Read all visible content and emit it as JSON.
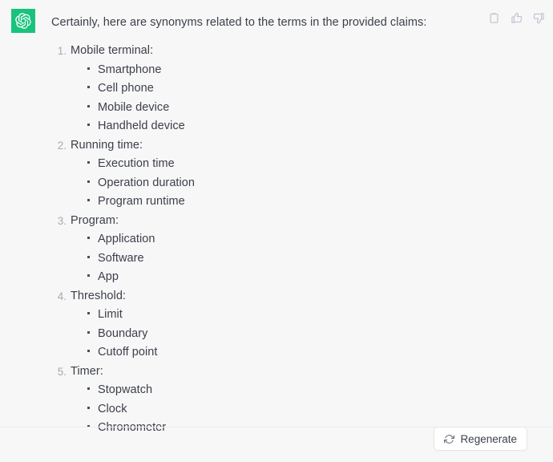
{
  "avatar": {
    "icon": "openai-logo-icon",
    "background": "#19c37d"
  },
  "message": {
    "intro": "Certainly, here are synonyms related to the terms in the provided claims:",
    "items": [
      {
        "number": "1.",
        "term": "Mobile terminal:",
        "synonyms": [
          "Smartphone",
          "Cell phone",
          "Mobile device",
          "Handheld device"
        ]
      },
      {
        "number": "2.",
        "term": "Running time:",
        "synonyms": [
          "Execution time",
          "Operation duration",
          "Program runtime"
        ]
      },
      {
        "number": "3.",
        "term": "Program:",
        "synonyms": [
          "Application",
          "Software",
          "App"
        ]
      },
      {
        "number": "4.",
        "term": "Threshold:",
        "synonyms": [
          "Limit",
          "Boundary",
          "Cutoff point"
        ]
      },
      {
        "number": "5.",
        "term": "Timer:",
        "synonyms": [
          "Stopwatch",
          "Clock",
          "Chronometer"
        ]
      }
    ]
  },
  "actions": [
    {
      "name": "copy-icon",
      "label": "Copy"
    },
    {
      "name": "thumbs-up-icon",
      "label": "Good response"
    },
    {
      "name": "thumbs-down-icon",
      "label": "Bad response"
    }
  ],
  "footer": {
    "regenerate_label": "Regenerate",
    "regenerate_icon": "refresh-icon"
  },
  "colors": {
    "background": "#f7f7f8",
    "text": "#3c4049",
    "marker": "#a7a9b4",
    "accent": "#19c37d",
    "icon": "#c5c5d2",
    "border": "#ececf1"
  }
}
